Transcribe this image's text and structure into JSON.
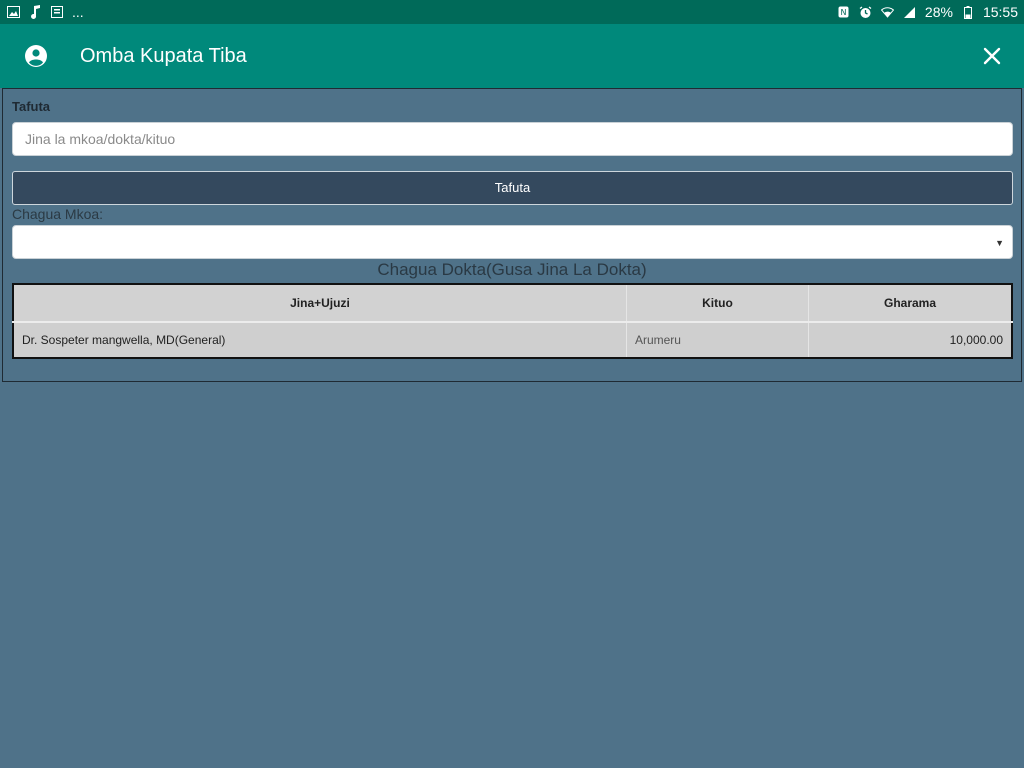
{
  "status_bar": {
    "left_ellipsis": "...",
    "battery_percent": "28%",
    "time": "15:55",
    "left_icons": [
      "image-icon",
      "music-note-icon",
      "notification-icon"
    ],
    "right_icons": [
      "nfc-icon",
      "alarm-icon",
      "wifi-icon",
      "signal-icon",
      "battery-icon"
    ]
  },
  "app_bar": {
    "title": "Omba Kupata Tiba",
    "icons": [
      "account-circle-icon",
      "close-icon"
    ],
    "color": "#00897b"
  },
  "search": {
    "label": "Tafuta",
    "placeholder": "Jina la mkoa/dokta/kituo",
    "value": "",
    "button_label": "Tafuta"
  },
  "region": {
    "label": "Chagua Mkoa:",
    "selected": ""
  },
  "doctors": {
    "heading": "Chagua Dokta(Gusa Jina La Dokta)",
    "columns": [
      "Jina+Ujuzi",
      "Kituo",
      "Gharama"
    ],
    "rows": [
      [
        "Dr. Sospeter mangwella, MD(General)",
        "Arumeru",
        "10,000.00"
      ]
    ]
  },
  "colors": {
    "status_bar": "#006a59",
    "background": "#4f7289",
    "button": "#34495e"
  }
}
